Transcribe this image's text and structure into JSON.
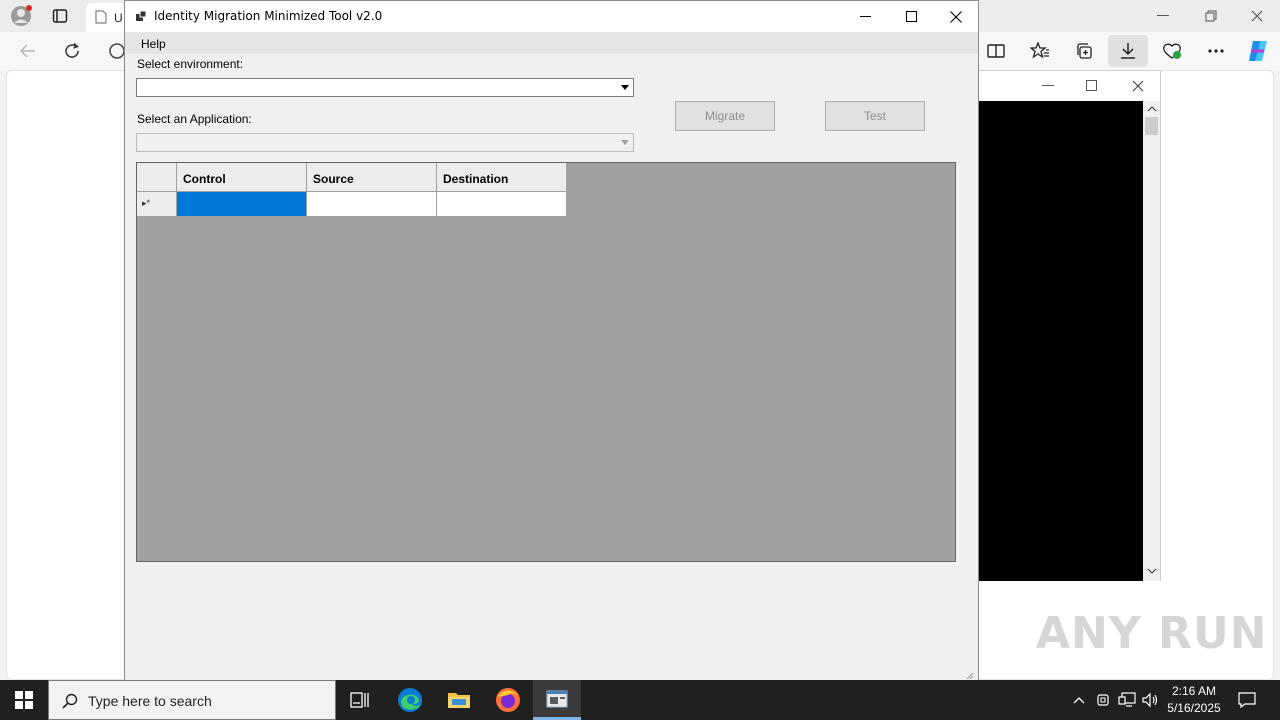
{
  "browser": {
    "tab_title": "U"
  },
  "console": {},
  "app": {
    "title": "Identity Migration Minimized Tool v2.0",
    "menu": {
      "help": "Help"
    },
    "env_label": "Select environment:",
    "env_value": "",
    "app_label": "Select an Application:",
    "app_value": "",
    "migrate_label": "Migrate",
    "test_label": "Test",
    "grid": {
      "columns": [
        "Control",
        "Source",
        "Destination"
      ],
      "new_row_marker": "▸*",
      "rows": [
        [
          "",
          "",
          ""
        ]
      ]
    }
  },
  "taskbar": {
    "search_placeholder": "Type here to search",
    "time": "2:16 AM",
    "date": "5/16/2025"
  },
  "watermark": "ANY RUN"
}
